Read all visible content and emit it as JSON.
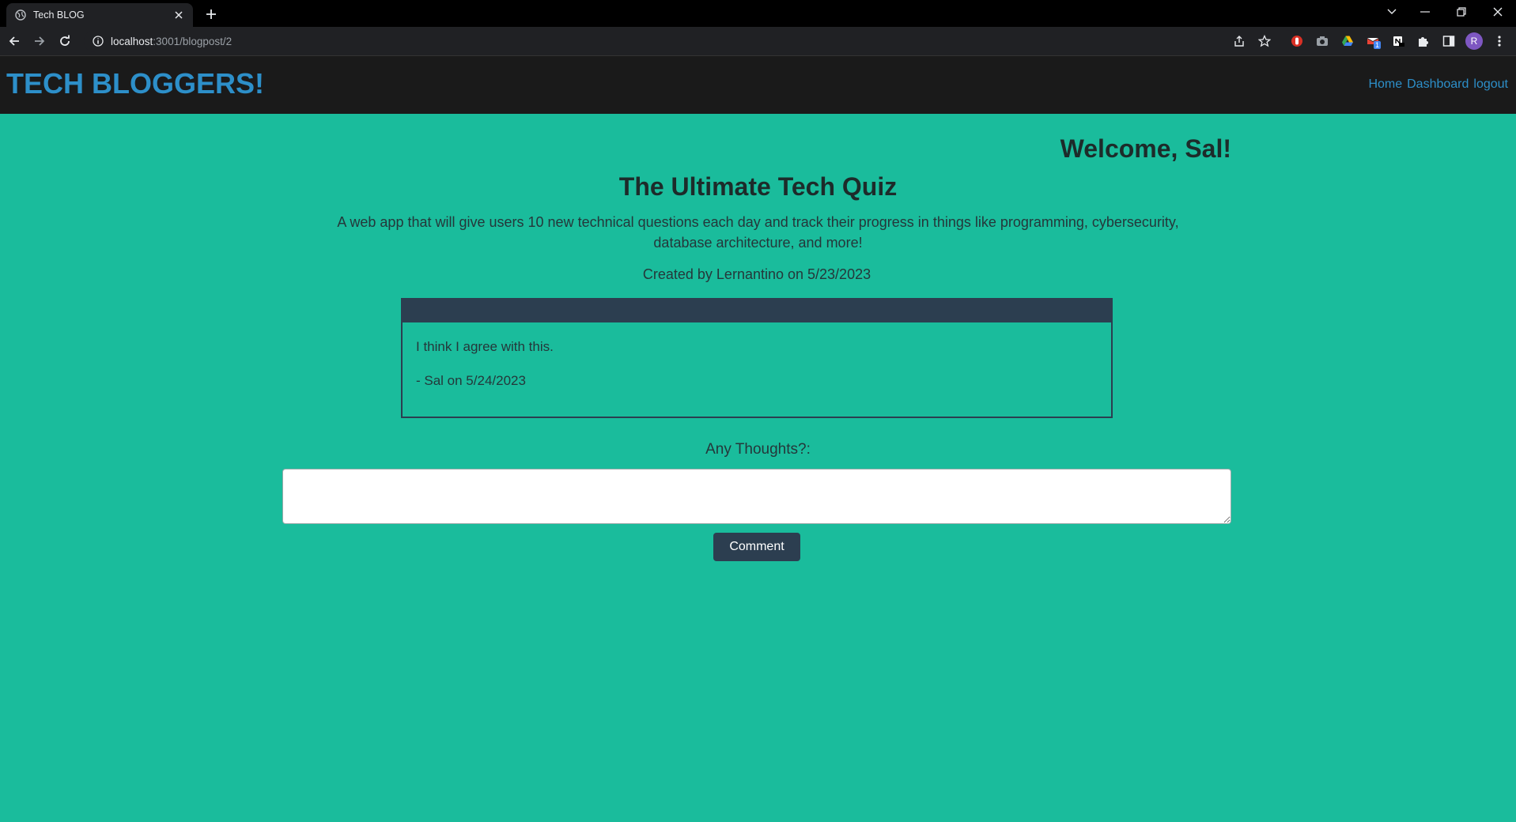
{
  "browser": {
    "tab_title": "Tech BLOG",
    "url_host": "localhost",
    "url_path": ":3001/blogpost/2",
    "profile_initial": "R",
    "extension_badge": "1"
  },
  "header": {
    "brand": "TECH BLOGGERS!",
    "nav": [
      "Home",
      "Dashboard",
      "logout"
    ]
  },
  "main": {
    "welcome": "Welcome, Sal!",
    "post": {
      "title": "The Ultimate Tech Quiz",
      "body": "A web app that will give users 10 new technical questions each day and track their progress in things like programming, cybersecurity, database architecture, and more!",
      "meta": "Created by Lernantino on 5/23/2023"
    },
    "comments": [
      {
        "text": "I think I agree with this.",
        "byline": "- Sal on 5/24/2023"
      }
    ],
    "form": {
      "label": "Any Thoughts?:",
      "value": "",
      "button": "Comment"
    }
  },
  "colors": {
    "page_bg": "#1abc9c",
    "header_bg": "#1a1a1a",
    "brand": "#2d8fc9",
    "accent_dark": "#2c3e50"
  }
}
